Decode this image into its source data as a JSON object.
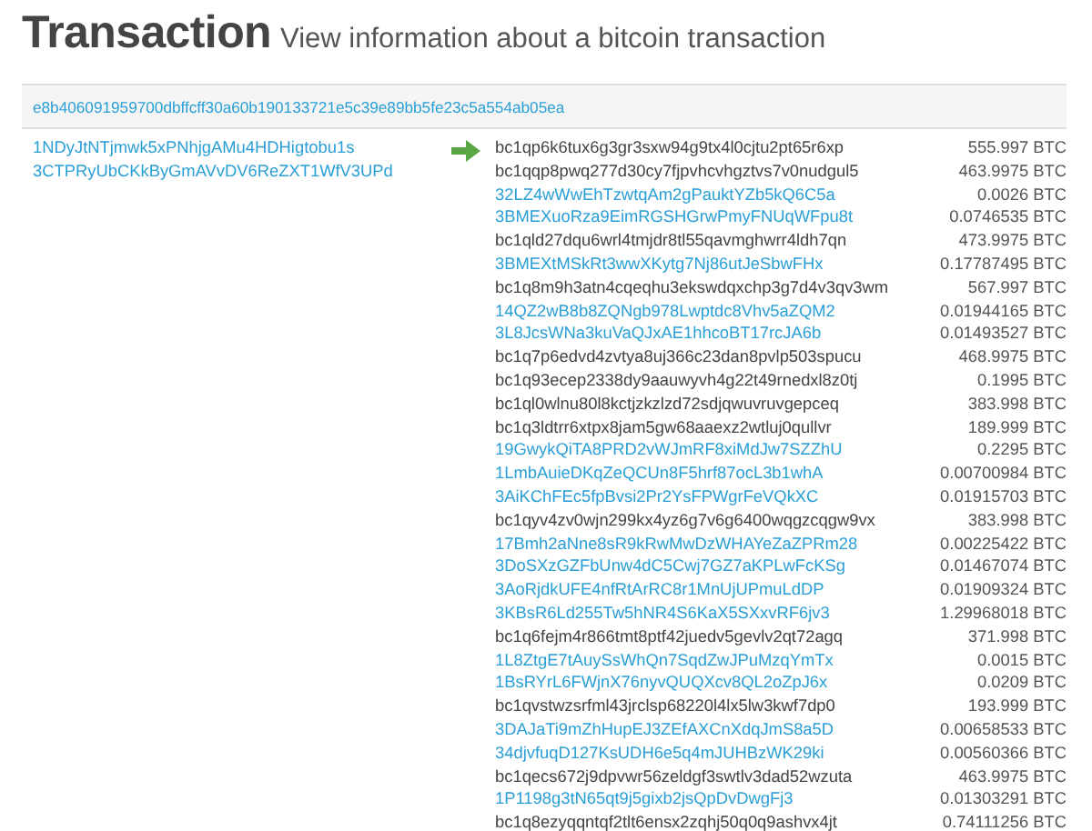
{
  "header": {
    "title": "Transaction",
    "subtitle": "View information about a bitcoin transaction"
  },
  "transaction": {
    "hash": "e8b406091959700dbffcff30a60b190133721e5c39e89bb5fe23c5a554ab05ea",
    "inputs": [
      {
        "address": "1NDyJtNTjmwk5xPNhjgAMu4HDHigtobu1s"
      },
      {
        "address": "3CTPRyUbCKkByGmAVvDV6ReZXT1WfV3UPd"
      }
    ],
    "outputs": [
      {
        "address": "bc1qp6k6tux6g3gr3sxw94g9tx4l0cjtu2pt65r6xp",
        "amount": "555.997 BTC",
        "linked": false
      },
      {
        "address": "bc1qqp8pwq277d30cy7fjpvhcvhgztvs7v0nudgul5",
        "amount": "463.9975 BTC",
        "linked": false
      },
      {
        "address": "32LZ4wWwEhTzwtqAm2gPauktYZb5kQ6C5a",
        "amount": "0.0026 BTC",
        "linked": true
      },
      {
        "address": "3BMEXuoRza9EimRGSHGrwPmyFNUqWFpu8t",
        "amount": "0.0746535 BTC",
        "linked": true
      },
      {
        "address": "bc1qld27dqu6wrl4tmjdr8tl55qavmghwrr4ldh7qn",
        "amount": "473.9975 BTC",
        "linked": false
      },
      {
        "address": "3BMEXtMSkRt3wwXKytg7Nj86utJeSbwFHx",
        "amount": "0.17787495 BTC",
        "linked": true
      },
      {
        "address": "bc1q8m9h3atn4cqeqhu3ekswdqxchp3g7d4v3qv3wm",
        "amount": "567.997 BTC",
        "linked": false
      },
      {
        "address": "14QZ2wB8b8ZQNgb978Lwptdc8Vhv5aZQM2",
        "amount": "0.01944165 BTC",
        "linked": true
      },
      {
        "address": "3L8JcsWNa3kuVaQJxAE1hhcoBT17rcJA6b",
        "amount": "0.01493527 BTC",
        "linked": true
      },
      {
        "address": "bc1q7p6edvd4zvtya8uj366c23dan8pvlp503spucu",
        "amount": "468.9975 BTC",
        "linked": false
      },
      {
        "address": "bc1q93ecep2338dy9aauwyvh4g22t49rnedxl8z0tj",
        "amount": "0.1995 BTC",
        "linked": false
      },
      {
        "address": "bc1ql0wlnu80l8kctjzkzlzd72sdjqwuvruvgepceq",
        "amount": "383.998 BTC",
        "linked": false
      },
      {
        "address": "bc1q3ldtrr6xtpx8jam5gw68aaexz2wtluj0qullvr",
        "amount": "189.999 BTC",
        "linked": false
      },
      {
        "address": "19GwykQiTA8PRD2vWJmRF8xiMdJw7SZZhU",
        "amount": "0.2295 BTC",
        "linked": true
      },
      {
        "address": "1LmbAuieDKqZeQCUn8F5hrf87ocL3b1whA",
        "amount": "0.00700984 BTC",
        "linked": true
      },
      {
        "address": "3AiKChFEc5fpBvsi2Pr2YsFPWgrFeVQkXC",
        "amount": "0.01915703 BTC",
        "linked": true
      },
      {
        "address": "bc1qyv4zv0wjn299kx4yz6g7v6g6400wqgzcqgw9vx",
        "amount": "383.998 BTC",
        "linked": false
      },
      {
        "address": "17Bmh2aNne8sR9kRwMwDzWHAYeZaZPRm28",
        "amount": "0.00225422 BTC",
        "linked": true
      },
      {
        "address": "3DoSXzGZFbUnw4dC5Cwj7GZ7aKPLwFcKSg",
        "amount": "0.01467074 BTC",
        "linked": true
      },
      {
        "address": "3AoRjdkUFE4nfRtArRC8r1MnUjUPmuLdDP",
        "amount": "0.01909324 BTC",
        "linked": true
      },
      {
        "address": "3KBsR6Ld255Tw5hNR4S6KaX5SXxvRF6jv3",
        "amount": "1.29968018 BTC",
        "linked": true
      },
      {
        "address": "bc1q6fejm4r866tmt8ptf42juedv5gevlv2qt72agq",
        "amount": "371.998 BTC",
        "linked": false
      },
      {
        "address": "1L8ZtgE7tAuySsWhQn7SqdZwJPuMzqYmTx",
        "amount": "0.0015 BTC",
        "linked": true
      },
      {
        "address": "1BsRYrL6FWjnX76nyvQUQXcv8QL2oZpJ6x",
        "amount": "0.0209 BTC",
        "linked": true
      },
      {
        "address": "bc1qvstwzsrfml43jrclsp68220l4lx5lw3kwf7dp0",
        "amount": "193.999 BTC",
        "linked": false
      },
      {
        "address": "3DAJaTi9mZhHupEJ3ZEfAXCnXdqJmS8a5D",
        "amount": "0.00658533 BTC",
        "linked": true
      },
      {
        "address": "34djvfuqD127KsUDH6e5q4mJUHBzWK29ki",
        "amount": "0.00560366 BTC",
        "linked": true
      },
      {
        "address": "bc1qecs672j9dpvwr56zeldgf3swtlv3dad52wzuta",
        "amount": "463.9975 BTC",
        "linked": false
      },
      {
        "address": "1P1198g3tN65qt9j5gixb2jsQpDvDwgFj3",
        "amount": "0.01303291 BTC",
        "linked": true
      },
      {
        "address": "bc1q8ezyqqntqf2tlt6ensx2zqhj50q0q9ashvx4jt",
        "amount": "0.74111256 BTC",
        "linked": false
      }
    ]
  }
}
